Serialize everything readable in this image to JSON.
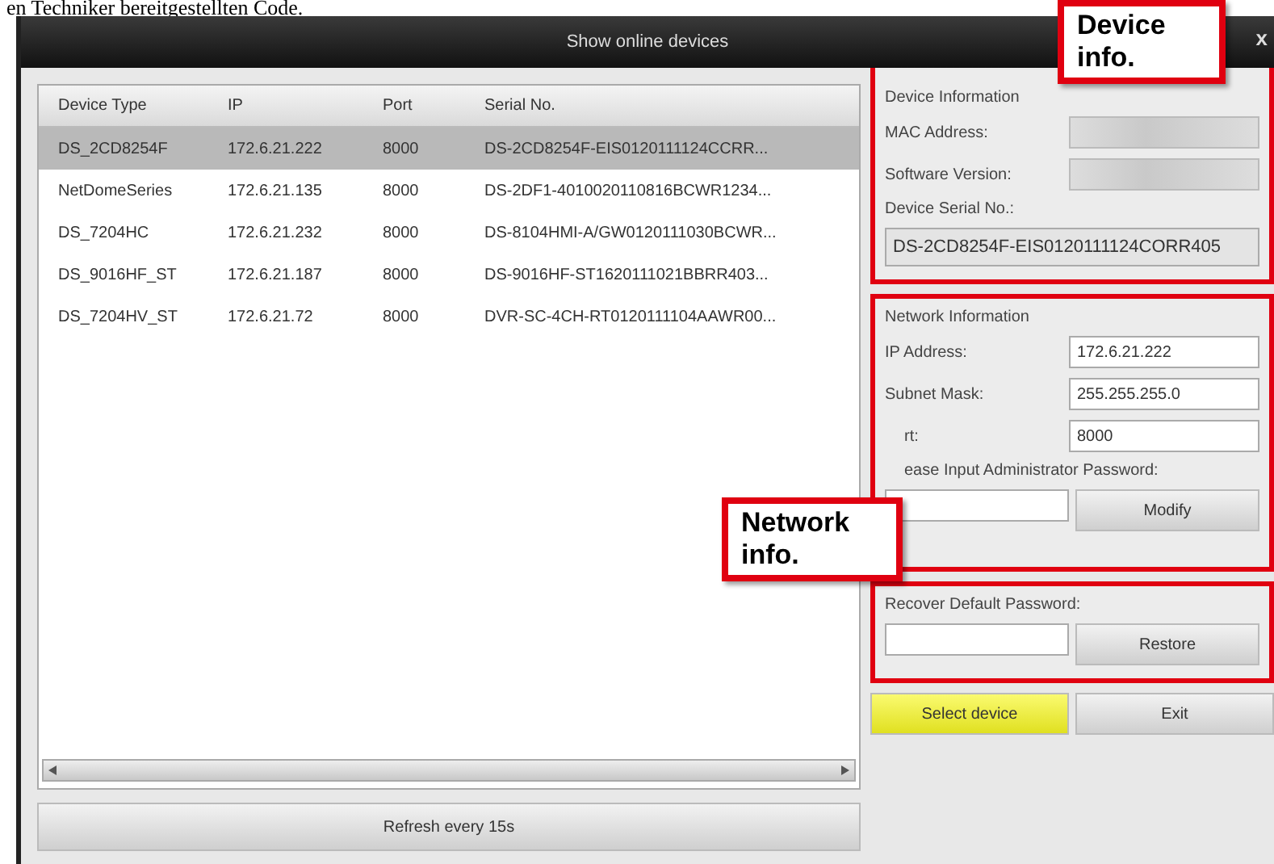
{
  "caption": "en Techniker bereitgestellten Code.",
  "window": {
    "title": "Show online devices",
    "close": "x"
  },
  "table": {
    "columns": [
      "Device Type",
      "IP",
      "Port",
      "Serial No."
    ],
    "rows": [
      {
        "cells": [
          "DS_2CD8254F",
          "172.6.21.222",
          "8000",
          "DS-2CD8254F-EIS0120111124CCRR..."
        ],
        "selected": true
      },
      {
        "cells": [
          "NetDomeSeries",
          "172.6.21.135",
          "8000",
          "DS-2DF1-4010020110816BCWR1234..."
        ],
        "selected": false
      },
      {
        "cells": [
          "DS_7204HC",
          "172.6.21.232",
          "8000",
          "DS-8104HMI-A/GW0120111030BCWR..."
        ],
        "selected": false
      },
      {
        "cells": [
          "DS_9016HF_ST",
          "172.6.21.187",
          "8000",
          "DS-9016HF-ST1620111021BBRR403..."
        ],
        "selected": false
      },
      {
        "cells": [
          "DS_7204HV_ST",
          "172.6.21.72",
          "8000",
          "DVR-SC-4CH-RT0120111104AAWR00..."
        ],
        "selected": false
      }
    ]
  },
  "refresh_button": "Refresh every 15s",
  "device_information": {
    "heading": "Device Information",
    "mac_label": "MAC Address:",
    "software_label": "Software Version:",
    "serial_label": "Device Serial No.:",
    "serial_value": "DS-2CD8254F-EIS0120111124CORR405"
  },
  "network_information": {
    "heading": "Network Information",
    "ip_label": "IP Address:",
    "ip_value": "172.6.21.222",
    "mask_label": "Subnet Mask:",
    "mask_value": "255.255.255.0",
    "port_label": "rt:",
    "port_value": "8000",
    "password_label": "ease Input Administrator Password:",
    "modify_button": "Modify"
  },
  "recover": {
    "heading": "Recover Default Password:",
    "restore_button": "Restore"
  },
  "buttons": {
    "select": "Select device",
    "exit": "Exit"
  },
  "callouts": [
    {
      "text": "Device info.",
      "kind": "top"
    },
    {
      "text": "Network info.",
      "kind": "side"
    }
  ]
}
